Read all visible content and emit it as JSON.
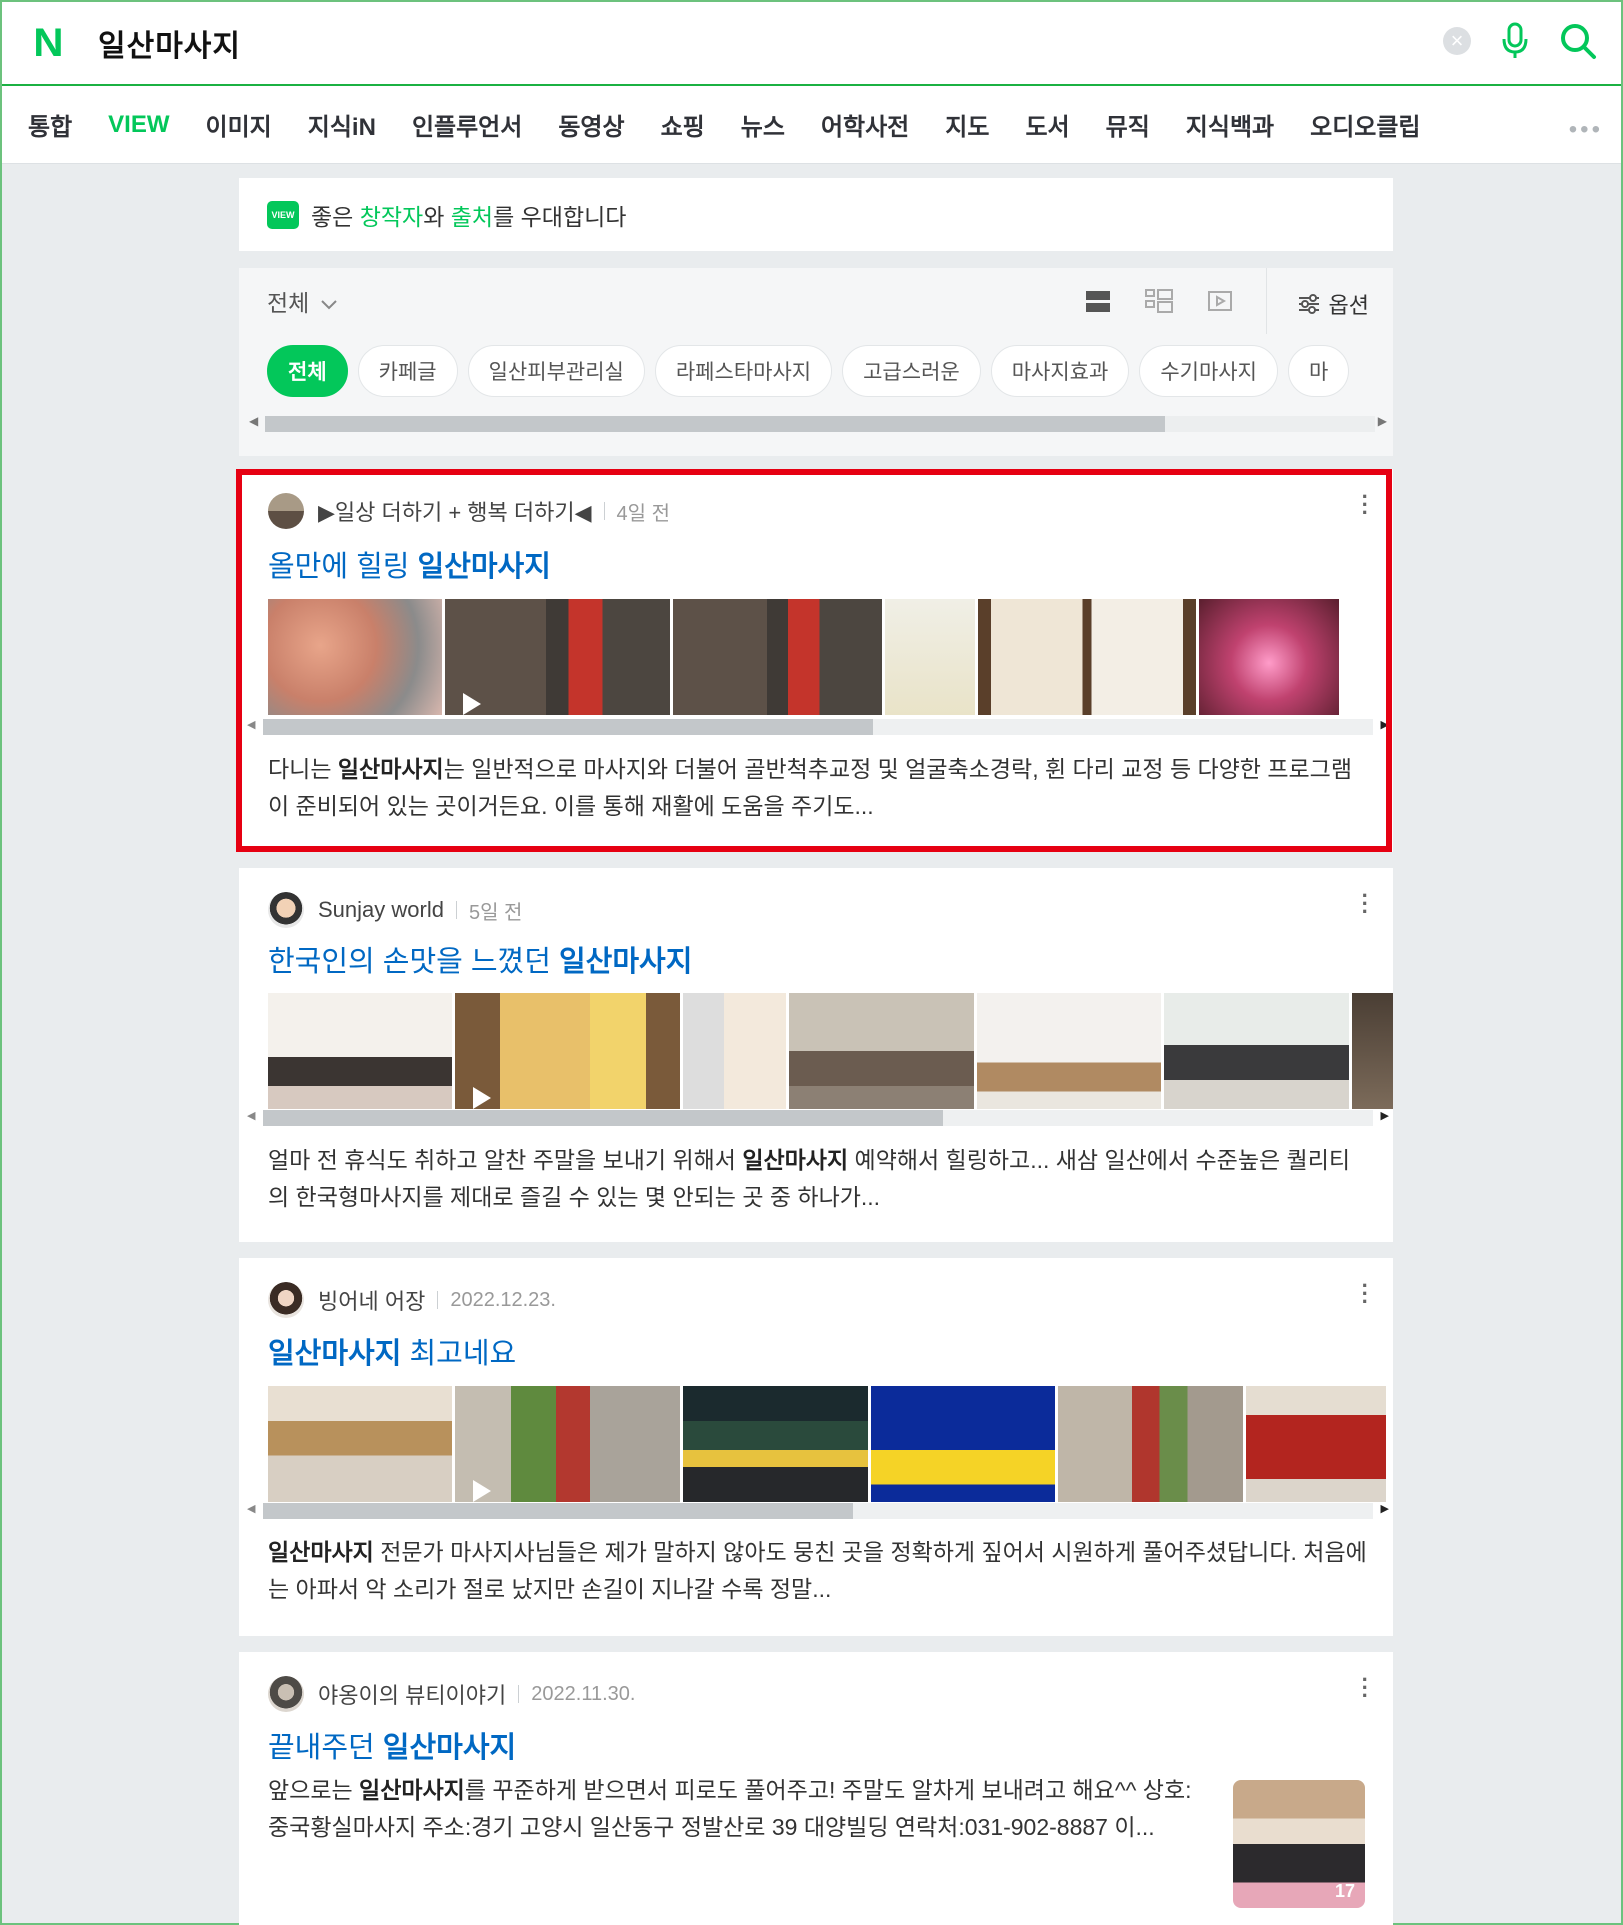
{
  "search": {
    "query": "일산마사지",
    "logo": "N"
  },
  "nav": {
    "items": [
      "통합",
      "VIEW",
      "이미지",
      "지식iN",
      "인플루언서",
      "동영상",
      "쇼핑",
      "뉴스",
      "어학사전",
      "지도",
      "도서",
      "뮤직",
      "지식백과",
      "오디오클립"
    ],
    "active_index": 1,
    "more": "•••"
  },
  "banner": {
    "badge": "VIEW",
    "text_1": "좋은 ",
    "highlight_1": "창작자",
    "text_2": "와 ",
    "highlight_2": "출처",
    "text_3": "를 우대합니다"
  },
  "filter": {
    "all_label": "전체",
    "options_label": "옵션",
    "chips": [
      "전체",
      "카페글",
      "일산피부관리실",
      "라페스타마사지",
      "고급스러운",
      "마사지효과",
      "수기마사지",
      "마"
    ]
  },
  "results": [
    {
      "author": "▶일상 더하기 + 행복 더하기◀",
      "date": "4일 전",
      "title_plain": "올만에 힐링 ",
      "title_bold": "일산마사지",
      "title_after": "",
      "desc_pre": "다니는 ",
      "desc_bold": "일산마사지",
      "desc_post": "는 일반적으로 마사지와 더불어 골반척추교정 및 얼굴축소경락, 휜 다리 교정 등 다양한 프로그램이 준비되어 있는 곳이거든요. 이를 통해 재활에 도움을 주기도..."
    },
    {
      "author": "Sunjay world",
      "date": "5일 전",
      "title_plain": "한국인의 손맛을 느꼈던 ",
      "title_bold": "일산마사지",
      "title_after": "",
      "desc_pre": "얼마 전 휴식도 취하고 알찬 주말을 보내기 위해서 ",
      "desc_bold": "일산마사지",
      "desc_post": " 예약해서 힐링하고... 새삼 일산에서 수준높은 퀄리티의 한국형마사지를 제대로 즐길 수 있는 몇 안되는 곳 중 하나가..."
    },
    {
      "author": "빙어네 어장",
      "date": "2022.12.23.",
      "title_plain": "",
      "title_bold": "일산마사지",
      "title_after": " 최고네요",
      "desc_pre": "",
      "desc_bold": "일산마사지",
      "desc_post": " 전문가 마사지사님들은 제가 말하지 않아도 뭉친 곳을 정확하게 짚어서 시원하게 풀어주셨답니다. 처음에는 아파서 악 소리가 절로 났지만 손길이 지나갈 수록 정말..."
    },
    {
      "author": "야옹이의 뷰티이야기",
      "date": "2022.11.30.",
      "title_plain": "끝내주던 ",
      "title_bold": "일산마사지",
      "title_after": "",
      "desc_pre": "앞으로는 ",
      "desc_bold": "일산마사지",
      "desc_post": "를 꾸준하게 받으면서 피로도 풀어주고! 주말도 알차게 보내려고 해요^^ 상호:중국황실마사지 주소:경기 고양시 일산동구 정발산로 39 대양빌딩 연락처:031-902-8887 이...",
      "image_count": "17"
    }
  ],
  "colors": {
    "brand": "#03c75a",
    "link": "#0068c3",
    "highlight": "#e60012"
  }
}
